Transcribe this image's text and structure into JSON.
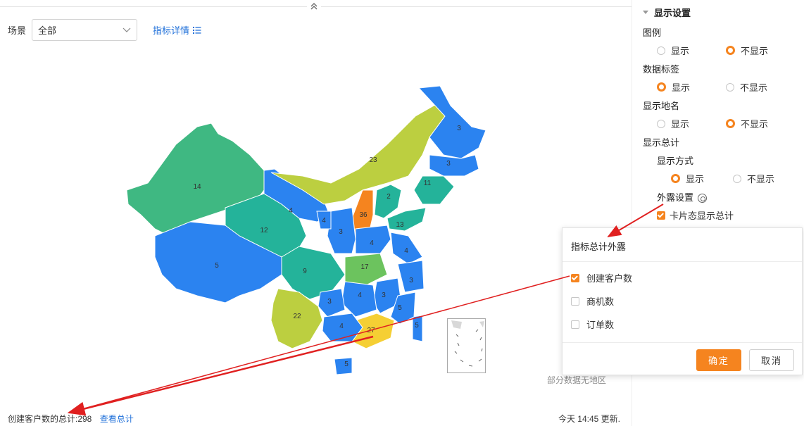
{
  "filter": {
    "label": "场景",
    "value": "全部",
    "detail_link": "指标详情"
  },
  "map": {
    "regions": [
      {
        "name": "xinjiang",
        "value": "14",
        "color": "#3fb882"
      },
      {
        "name": "tibet",
        "value": "5",
        "color": "#2b83f0"
      },
      {
        "name": "qinghai",
        "value": "12",
        "color": "#24b39a"
      },
      {
        "name": "gansu",
        "value": "4",
        "color": "#2b83f0"
      },
      {
        "name": "inner-mongolia",
        "value": "23",
        "color": "#bccf40"
      },
      {
        "name": "heilongjiang",
        "value": "3",
        "color": "#2b83f0"
      },
      {
        "name": "jilin",
        "value": "3",
        "color": "#2b83f0"
      },
      {
        "name": "liaoning",
        "value": "11",
        "color": "#24b39a"
      },
      {
        "name": "shanxi",
        "value": "36",
        "color": "#f5841f"
      },
      {
        "name": "shandong",
        "value": "13",
        "color": "#24b39a"
      },
      {
        "name": "sichuan",
        "value": "9",
        "color": "#24b39a"
      },
      {
        "name": "hubei",
        "value": "17",
        "color": "#6cc35e"
      },
      {
        "name": "yunnan",
        "value": "22",
        "color": "#bccf40"
      },
      {
        "name": "guangdong",
        "value": "27",
        "color": "#f5cf34"
      },
      {
        "name": "hainan",
        "value": "5",
        "color": "#2b83f0"
      },
      {
        "name": "taiwan",
        "value": "5",
        "color": "#2b83f0"
      },
      {
        "name": "henan",
        "value": "4",
        "color": "#2b83f0"
      },
      {
        "name": "jiangsu",
        "value": "4",
        "color": "#2b83f0"
      },
      {
        "name": "zhejiang",
        "value": "3",
        "color": "#2b83f0"
      },
      {
        "name": "jiangxi",
        "value": "3",
        "color": "#2b83f0"
      },
      {
        "name": "hunan",
        "value": "4",
        "color": "#2b83f0"
      },
      {
        "name": "guizhou",
        "value": "3",
        "color": "#2b83f0"
      },
      {
        "name": "guangxi",
        "value": "4",
        "color": "#2b83f0"
      },
      {
        "name": "fujian",
        "value": "5",
        "color": "#2b83f0"
      },
      {
        "name": "shaanxi",
        "value": "3",
        "color": "#2b83f0"
      },
      {
        "name": "ningxia",
        "value": "4",
        "color": "#2b83f0"
      },
      {
        "name": "hebei",
        "value": "2",
        "color": "#24b39a"
      }
    ],
    "nodata_note": "部分数据无地区"
  },
  "footer": {
    "total_label": "创建客户数的总计:298",
    "view_total": "查看总计",
    "updated": "今天 14:45 更新."
  },
  "panel": {
    "title": "显示设置",
    "legend": {
      "label": "图例",
      "show": "显示",
      "hide": "不显示",
      "selected": "hide"
    },
    "data_labels": {
      "label": "数据标签",
      "show": "显示",
      "hide": "不显示",
      "selected": "show"
    },
    "place_names": {
      "label": "显示地名",
      "show": "显示",
      "hide": "不显示",
      "selected": "hide"
    },
    "show_total": {
      "label": "显示总计",
      "mode_label": "显示方式",
      "show": "显示",
      "hide": "不显示",
      "selected": "show",
      "exposure_label": "外露设置",
      "card_total": "卡片态显示总计"
    }
  },
  "popup": {
    "title": "指标总计外露",
    "items": [
      {
        "label": "创建客户数",
        "checked": true
      },
      {
        "label": "商机数",
        "checked": false
      },
      {
        "label": "订单数",
        "checked": false
      }
    ],
    "ok": "确定",
    "cancel": "取消"
  },
  "colors": {
    "accent": "#f5841f",
    "link": "#1e6fd9",
    "annotation_arrow": "#e02020"
  }
}
